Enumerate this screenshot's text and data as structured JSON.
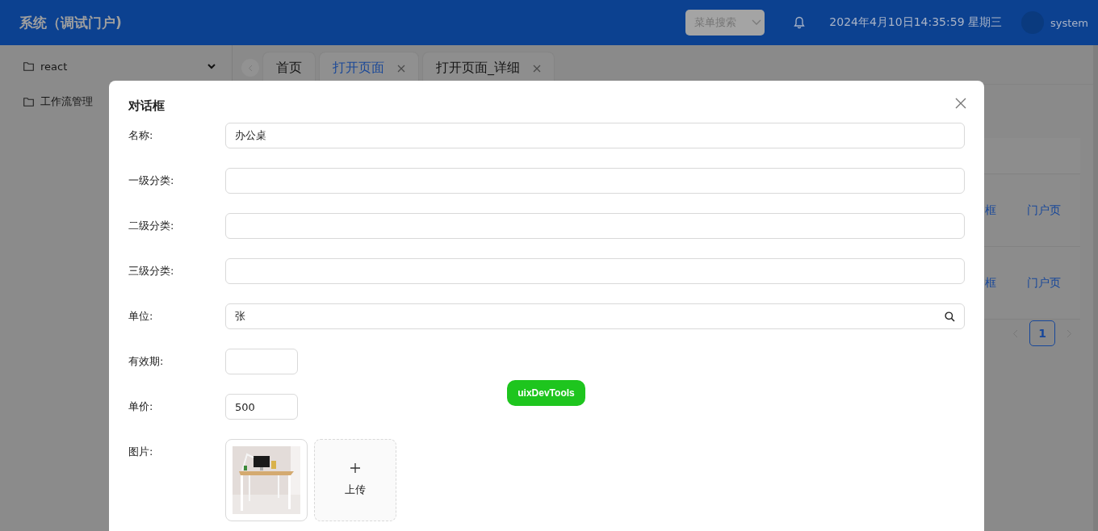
{
  "header": {
    "title": "系统（调试门户)",
    "menu_search": {
      "placeholder": "菜单搜索"
    },
    "datetime": "2024年4月10日14:35:59 星期三",
    "user": "system"
  },
  "sidebar": {
    "items": [
      {
        "label": "react",
        "kind": "submenu"
      },
      {
        "label": "工作流管理",
        "kind": "item"
      }
    ]
  },
  "tabs": [
    {
      "label": "首页",
      "selected": false,
      "closable": false
    },
    {
      "label": "打开页面",
      "selected": true,
      "closable": true
    },
    {
      "label": "打开页面_详细",
      "selected": false,
      "closable": true
    }
  ],
  "table": {
    "rows": [
      {
        "column_1": "框",
        "column_2": "门户页"
      },
      {
        "column_1": "框",
        "column_2": "门户页"
      }
    ]
  },
  "pagination": {
    "pages": [
      {
        "label": "1",
        "selected": true
      }
    ]
  },
  "dialog": {
    "title": "对话框",
    "fields": [
      {
        "kind": "text",
        "label": "名称:",
        "value": "办公桌"
      },
      {
        "kind": "text",
        "label": "一级分类:"
      },
      {
        "kind": "text",
        "label": "二级分类:"
      },
      {
        "kind": "text",
        "label": "三级分类:"
      },
      {
        "kind": "search",
        "label": "单位:",
        "value": "张"
      },
      {
        "kind": "short",
        "label": "有效期:"
      },
      {
        "kind": "short",
        "label": "单价:",
        "value": "500"
      },
      {
        "kind": "upload",
        "label": "图片:",
        "button": "上传"
      }
    ]
  },
  "dev_tools_button": "uixDevTools"
}
